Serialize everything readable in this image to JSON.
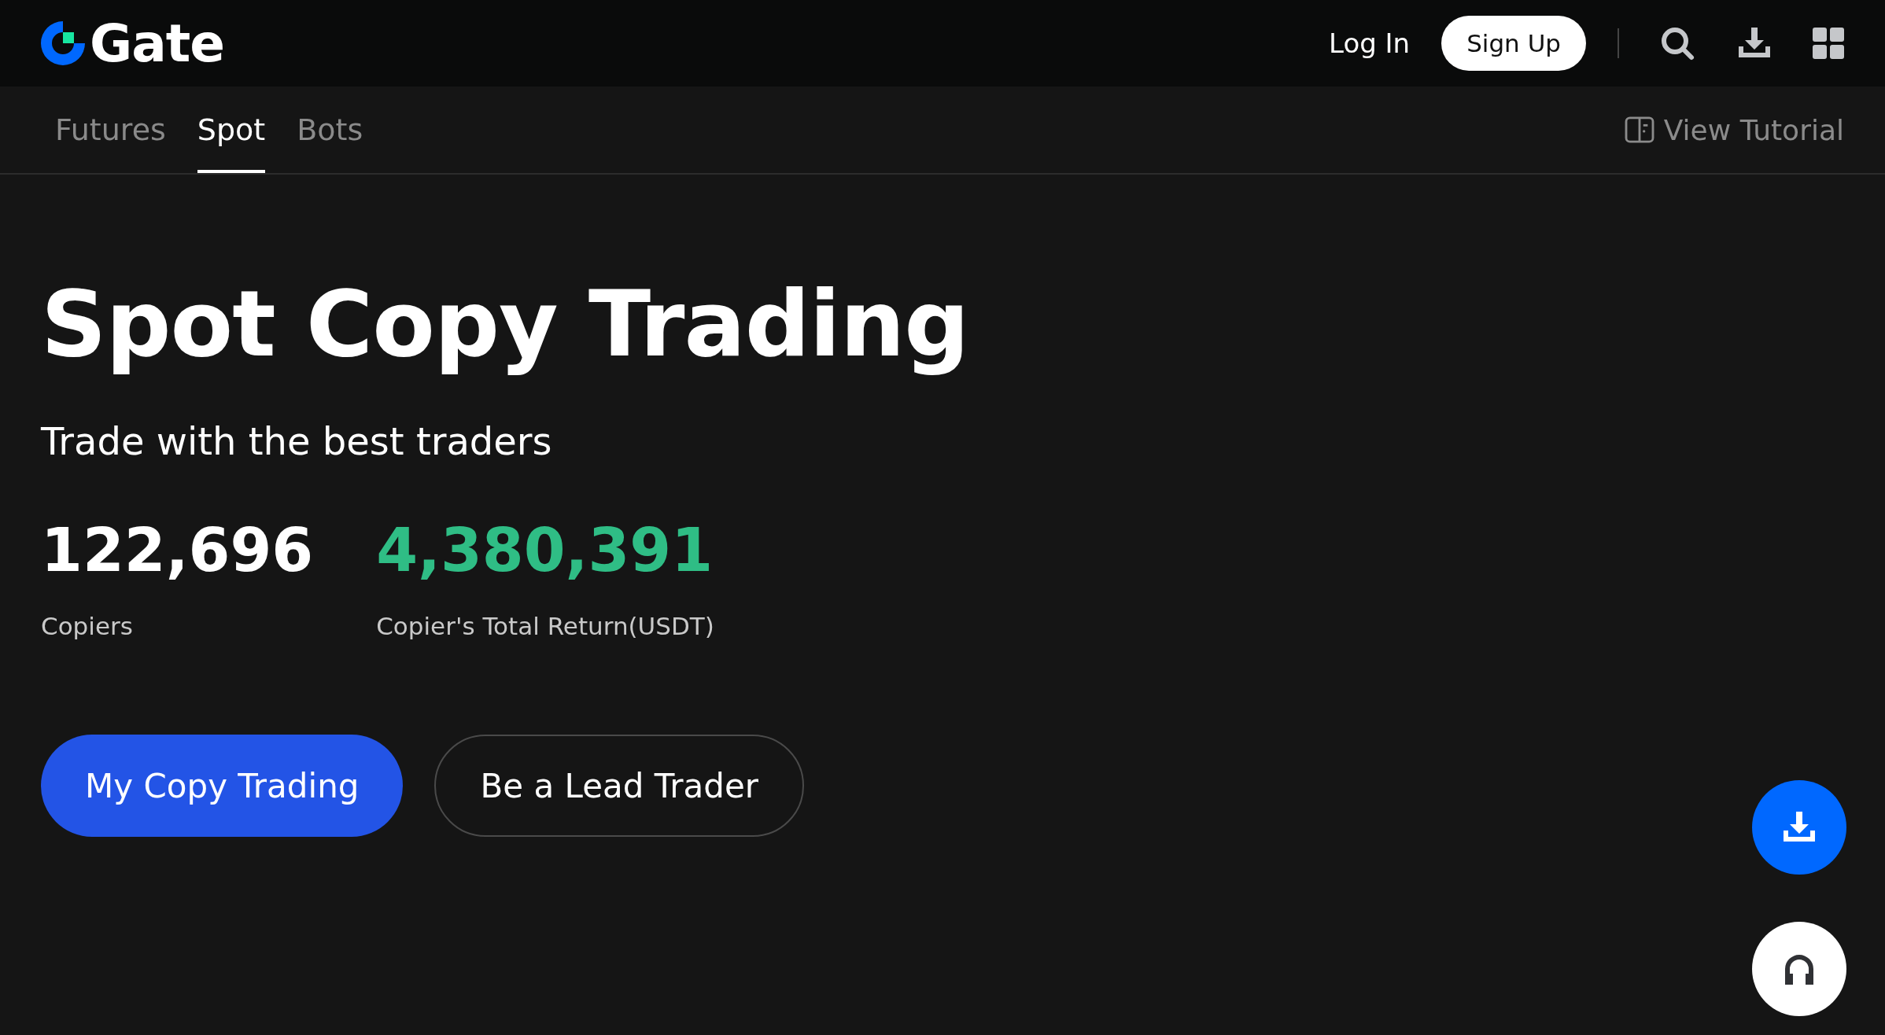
{
  "header": {
    "logo_text": "Gate",
    "login": "Log In",
    "signup": "Sign Up"
  },
  "tabs": [
    {
      "label": "Futures",
      "selected": false
    },
    {
      "label": "Spot",
      "selected": true
    },
    {
      "label": "Bots",
      "selected": false
    }
  ],
  "tutorial_link": "View Tutorial",
  "hero": {
    "title": "Spot Copy Trading",
    "subtitle": "Trade with the best traders",
    "stats": [
      {
        "value": "122,696",
        "label": "Copiers",
        "kind": "plain"
      },
      {
        "value": "4,380,391",
        "label": "Copier's Total Return(USDT)",
        "kind": "positive"
      }
    ],
    "buttons": [
      {
        "label": "My Copy Trading",
        "kind": "primary"
      },
      {
        "label": "Be a Lead Trader",
        "kind": "outline"
      }
    ]
  }
}
